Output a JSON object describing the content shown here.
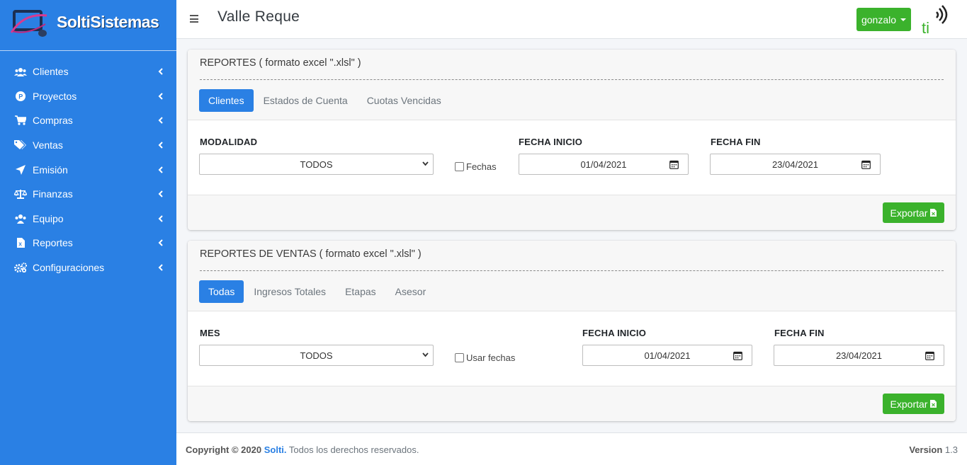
{
  "brand": {
    "name_part1": "Solti",
    "name_part2": "Sistemas"
  },
  "sidebar": {
    "items": [
      {
        "label": "Clientes",
        "icon": "users-icon"
      },
      {
        "label": "Proyectos",
        "icon": "project-icon"
      },
      {
        "label": "Compras",
        "icon": "cart-icon"
      },
      {
        "label": "Ventas",
        "icon": "tags-icon"
      },
      {
        "label": "Emisión",
        "icon": "send-icon"
      },
      {
        "label": "Finanzas",
        "icon": "balance-icon"
      },
      {
        "label": "Equipo",
        "icon": "team-icon"
      },
      {
        "label": "Reportes",
        "icon": "excel-file-icon"
      },
      {
        "label": "Configuraciones",
        "icon": "gears-icon"
      }
    ]
  },
  "header": {
    "title": "Valle Reque",
    "user": "gonzalo",
    "logo_text": "ti"
  },
  "card1": {
    "title": "REPORTES ( formato excel \".xlsl\" )",
    "tabs": [
      "Clientes",
      "Estados de Cuenta",
      "Cuotas Vencidas"
    ],
    "modalidad_label": "MODALIDAD",
    "modalidad_value": "TODOS",
    "checkbox_label": "Fechas",
    "fecha_inicio_label": "FECHA INICIO",
    "fecha_inicio_value": "01/04/2021",
    "fecha_fin_label": "FECHA FIN",
    "fecha_fin_value": "23/04/2021",
    "export_label": "Exportar"
  },
  "card2": {
    "title": "REPORTES DE VENTAS ( formato excel \".xlsl\" )",
    "tabs": [
      "Todas",
      "Ingresos Totales",
      "Etapas",
      "Asesor"
    ],
    "mes_label": "MES",
    "mes_value": "TODOS",
    "checkbox_label": "Usar fechas",
    "fecha_inicio_label": "FECHA INICIO",
    "fecha_inicio_value": "01/04/2021",
    "fecha_fin_label": "FECHA FIN",
    "fecha_fin_value": "23/04/2021",
    "export_label": "Exportar"
  },
  "footer": {
    "copyright": "Copyright © 2020",
    "company": "Solti.",
    "rights": "Todos los derechos reservados.",
    "version_label": "Version",
    "version_value": "1.3"
  },
  "colors": {
    "primary": "#2a80e4",
    "success": "#3bb22c"
  }
}
